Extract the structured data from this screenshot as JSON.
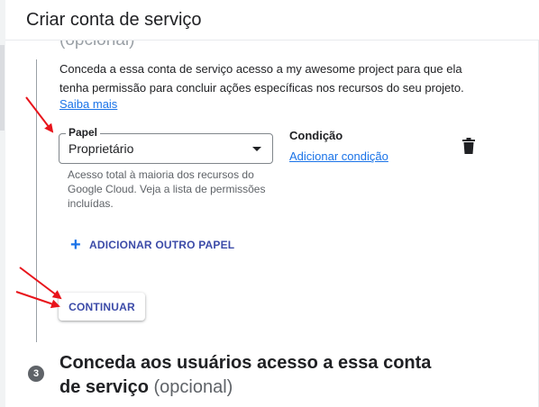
{
  "header": {
    "title": "Criar conta de serviço"
  },
  "step2": {
    "optional_label": "(opcional)",
    "description": "Conceda a essa conta de serviço acesso a my awesome project para que ela tenha permissão para concluir ações específicas nos recursos do seu projeto.",
    "learn_more": "Saiba mais",
    "role": {
      "legend": "Papel",
      "value": "Proprietário",
      "hint": "Acesso total à maioria dos recursos do Google Cloud. Veja a lista de permissões incluídas."
    },
    "condition": {
      "title": "Condição",
      "add_link": "Adicionar condição"
    },
    "add_role_label": "ADICIONAR OUTRO PAPEL",
    "continue_label": "CONTINUAR"
  },
  "step3": {
    "number": "3",
    "title": "Conceda aos usuários acesso a essa conta de serviço",
    "optional_label": "(opcional)"
  },
  "colors": {
    "accent": "#1a73e8",
    "annotation_arrow": "#e8141b",
    "step_badge": "#5f6368"
  },
  "icons": [
    "delete-icon",
    "plus-icon",
    "dropdown-caret-icon"
  ]
}
